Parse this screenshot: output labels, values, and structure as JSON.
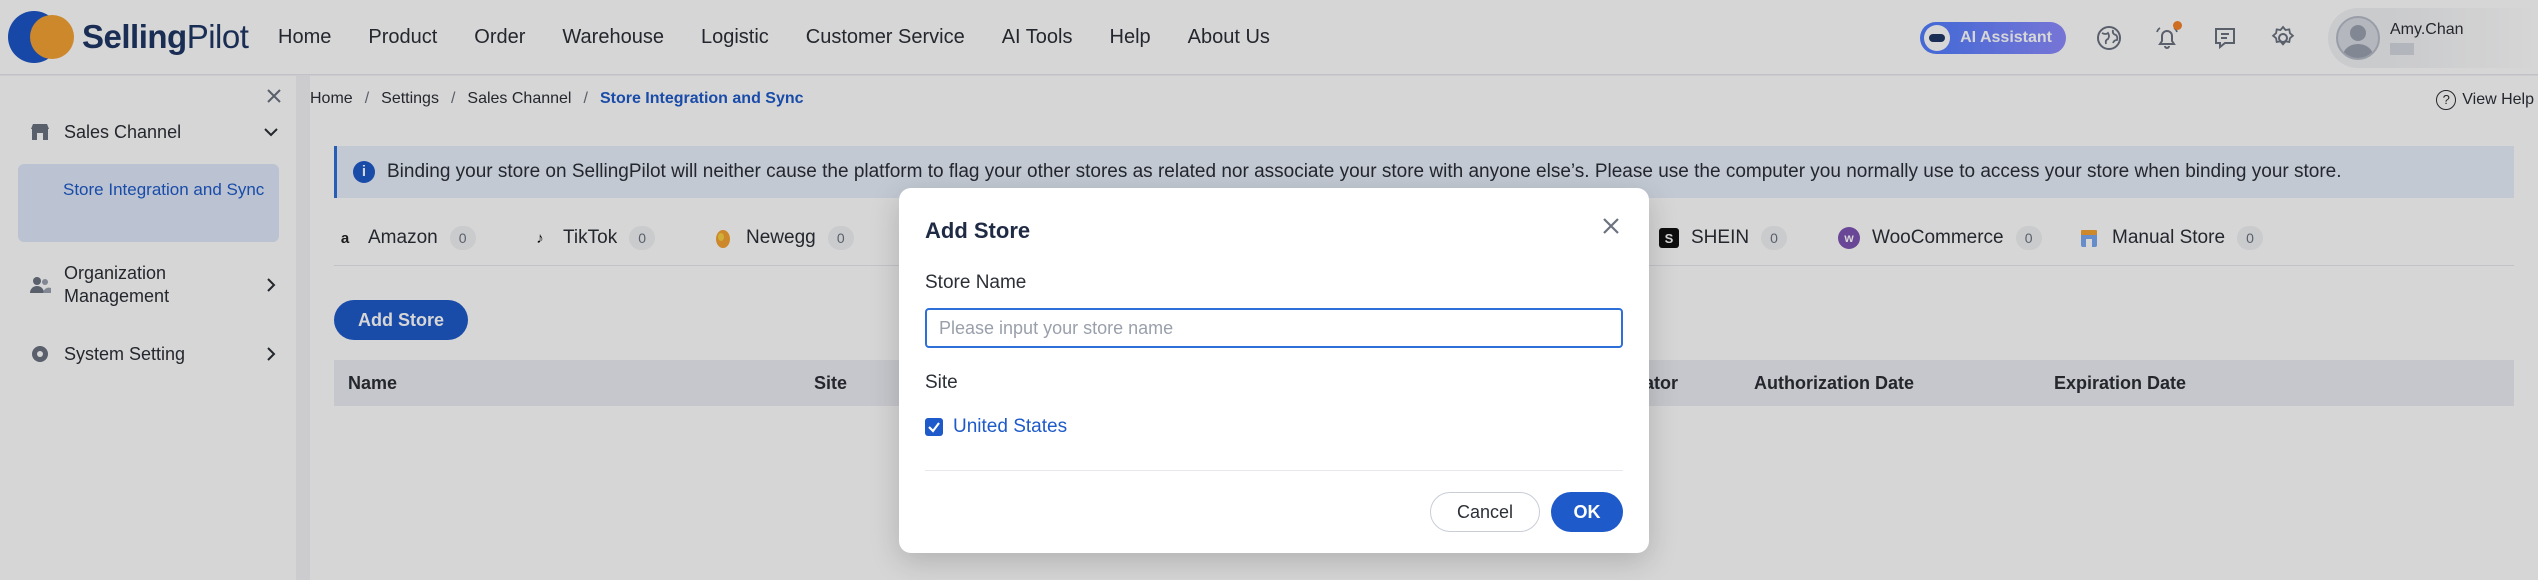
{
  "header": {
    "logo_bold": "Selling",
    "logo_light": "Pilot",
    "nav": [
      "Home",
      "Product",
      "Order",
      "Warehouse",
      "Logistic",
      "Customer Service",
      "AI Tools",
      "Help",
      "About Us"
    ],
    "ai_assistant_label": "AI Assistant",
    "user_name": "Amy.Chan",
    "notification_dot_color": "#f5832a"
  },
  "sidebar": {
    "sales_channel": "Sales Channel",
    "store_integration": "Store Integration and Sync",
    "organization_management": "Organization Management",
    "system_setting": "System Setting"
  },
  "breadcrumb": {
    "home": "Home",
    "settings": "Settings",
    "sales_channel": "Sales Channel",
    "current": "Store Integration and Sync",
    "separator": "/"
  },
  "view_help": "View Help",
  "notice": "Binding your store on SellingPilot will neither cause the platform to flag your other stores as related nor associate your store with anyone else’s. Please use the computer you normally use to access your store when binding your store.",
  "tabs": [
    {
      "label": "Amazon",
      "count": "0"
    },
    {
      "label": "TikTok",
      "count": "0"
    },
    {
      "label": "Newegg",
      "count": "0"
    },
    {
      "label": "SHEIN",
      "count": "0"
    },
    {
      "label": "WooCommerce",
      "count": "0"
    },
    {
      "label": "Manual Store",
      "count": "0"
    }
  ],
  "add_store_button": "Add Store",
  "table_headers": {
    "name": "Name",
    "site": "Site",
    "operator_partial": "ator",
    "authorization_date": "Authorization Date",
    "expiration_date": "Expiration Date"
  },
  "modal": {
    "title": "Add Store",
    "store_name_label": "Store Name",
    "store_name_placeholder": "Please input your store name",
    "store_name_value": "",
    "site_label": "Site",
    "site_option": "United States",
    "site_checked": true,
    "cancel_label": "Cancel",
    "ok_label": "OK"
  },
  "colors": {
    "primary": "#1e5ac9",
    "logo_orange": "#f4a233"
  }
}
